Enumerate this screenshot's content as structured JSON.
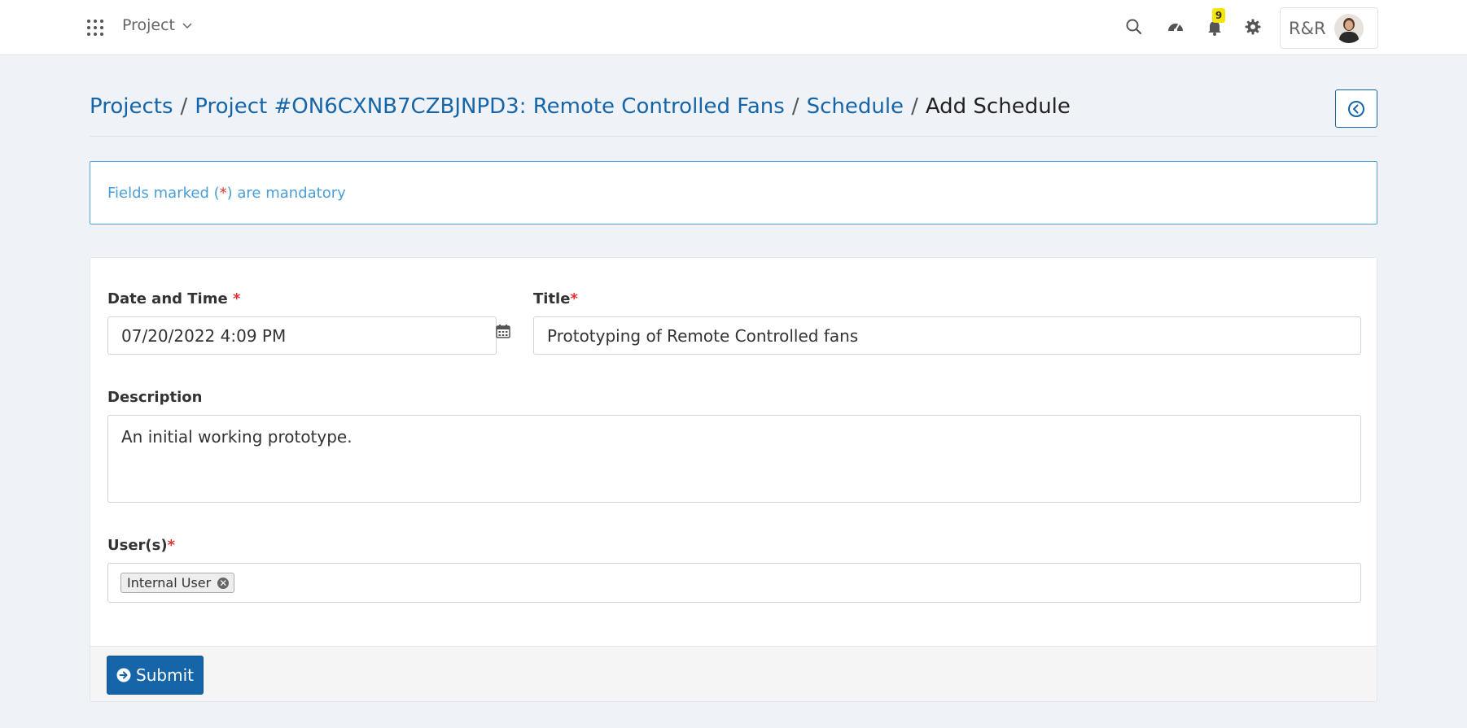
{
  "topbar": {
    "project_menu_label": "Project",
    "notification_count": "9",
    "user_initials": "R&R"
  },
  "breadcrumb": {
    "items": [
      "Projects",
      "Project #ON6CXNB7CZBJNPD3: Remote Controlled Fans",
      "Schedule"
    ],
    "current": "Add Schedule",
    "separator": "/"
  },
  "alert": {
    "prefix": "Fields marked (",
    "star": "*",
    "suffix": ") are mandatory"
  },
  "form": {
    "datetime": {
      "label": "Date and Time",
      "required_mark": "*",
      "value": "07/20/2022 4:09 PM"
    },
    "title": {
      "label": "Title",
      "required_mark": "*",
      "value": "Prototyping of Remote Controlled fans"
    },
    "description": {
      "label": "Description",
      "value": "An initial working prototype."
    },
    "users": {
      "label": "User(s)",
      "required_mark": "*",
      "selected": [
        "Internal User"
      ]
    },
    "submit_label": "Submit"
  },
  "colors": {
    "primary": "#1565a8",
    "alert_text": "#4a9ed8",
    "required": "#e03030",
    "badge": "#f5e50a",
    "page_bg": "#eff3f7"
  },
  "icons": [
    "apps-grid-icon",
    "chevron-down-icon",
    "search-icon",
    "dashboard-icon",
    "bell-icon",
    "gear-icon",
    "back-arrow-icon",
    "calendar-icon",
    "remove-icon",
    "arrow-circle-right-icon"
  ]
}
